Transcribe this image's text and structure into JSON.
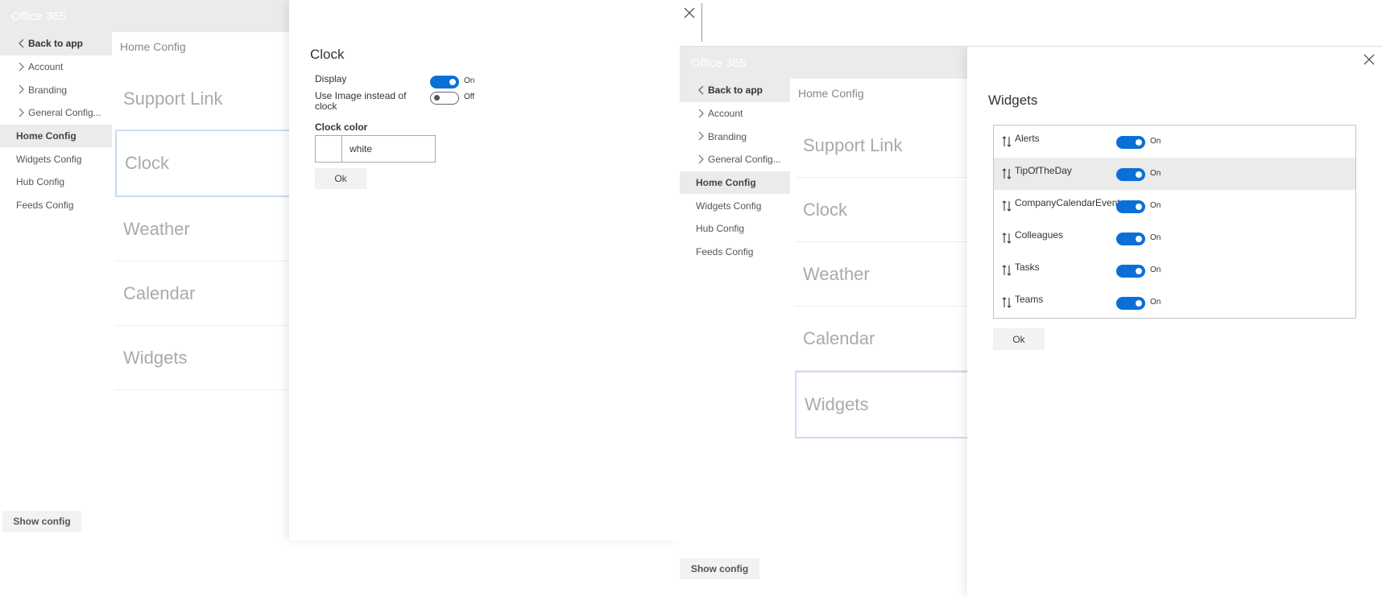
{
  "left": {
    "topbar_title": "Office 365",
    "nav": {
      "back": "Back to app",
      "items": [
        {
          "label": "Account"
        },
        {
          "label": "Branding"
        },
        {
          "label": "General Config..."
        }
      ],
      "pages": [
        {
          "label": "Home Config"
        },
        {
          "label": "Widgets Config"
        },
        {
          "label": "Hub Config"
        },
        {
          "label": "Feeds Config"
        }
      ]
    },
    "breadcrumb": "Home Config",
    "cards": [
      "Support Link",
      "Clock",
      "Weather",
      "Calendar",
      "Widgets"
    ],
    "show_config": "Show config",
    "flyout": {
      "title": "Clock",
      "display_label": "Display",
      "display_state": "On",
      "use_image_label": "Use Image instead of clock",
      "use_image_state": "Off",
      "clock_color_label": "Clock color",
      "clock_color_value": "white",
      "ok": "Ok"
    }
  },
  "right": {
    "topbar_title": "Office 365",
    "nav": {
      "back": "Back to app",
      "items": [
        {
          "label": "Account"
        },
        {
          "label": "Branding"
        },
        {
          "label": "General Config..."
        }
      ],
      "pages": [
        {
          "label": "Home Config"
        },
        {
          "label": "Widgets Config"
        },
        {
          "label": "Hub Config"
        },
        {
          "label": "Feeds Config"
        }
      ]
    },
    "breadcrumb": "Home Config",
    "cards": [
      "Support Link",
      "Clock",
      "Weather",
      "Calendar",
      "Widgets"
    ],
    "show_config": "Show config",
    "flyout": {
      "title": "Widgets",
      "widgets": [
        {
          "name": "Alerts",
          "state": "On"
        },
        {
          "name": "TipOfTheDay",
          "state": "On"
        },
        {
          "name": "CompanyCalendarEvents",
          "state": "On"
        },
        {
          "name": "Colleagues",
          "state": "On"
        },
        {
          "name": "Tasks",
          "state": "On"
        },
        {
          "name": "Teams",
          "state": "On"
        }
      ],
      "ok": "Ok"
    }
  },
  "colors": {
    "accent": "#0a6fd6",
    "nav_active_bg": "#ebebeb",
    "selected_card_border": "#c9dcf3"
  },
  "icons": {
    "close": "close-icon",
    "chevron": "chevron-right-icon",
    "back": "chevron-left-icon",
    "sort": "sort-icon"
  }
}
